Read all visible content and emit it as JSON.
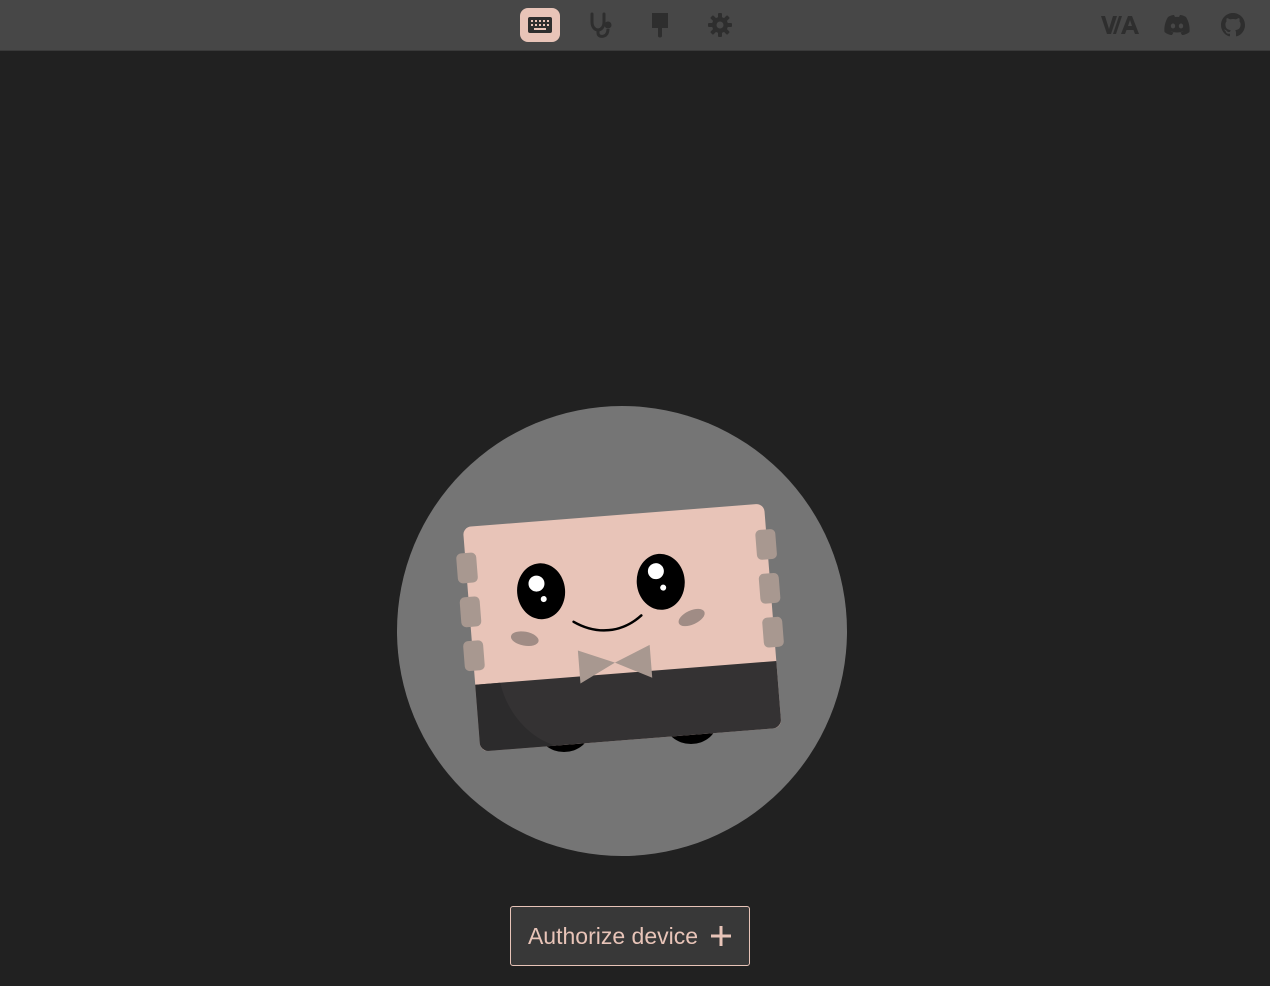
{
  "nav": {
    "items": [
      {
        "icon": "keyboard-icon",
        "active": true
      },
      {
        "icon": "stethoscope-icon",
        "active": false
      },
      {
        "icon": "paintbrush-icon",
        "active": false
      },
      {
        "icon": "gear-icon",
        "active": false
      }
    ]
  },
  "external_links": [
    {
      "icon": "via-logo-icon"
    },
    {
      "icon": "discord-icon"
    },
    {
      "icon": "github-icon"
    }
  ],
  "main": {
    "authorize_label": "Authorize device",
    "authorize_icon": "plus-icon"
  },
  "colors": {
    "accent": "#e8c4b8",
    "topbar": "#474747",
    "background": "#212121",
    "icon_muted": "#2e2e2e"
  }
}
